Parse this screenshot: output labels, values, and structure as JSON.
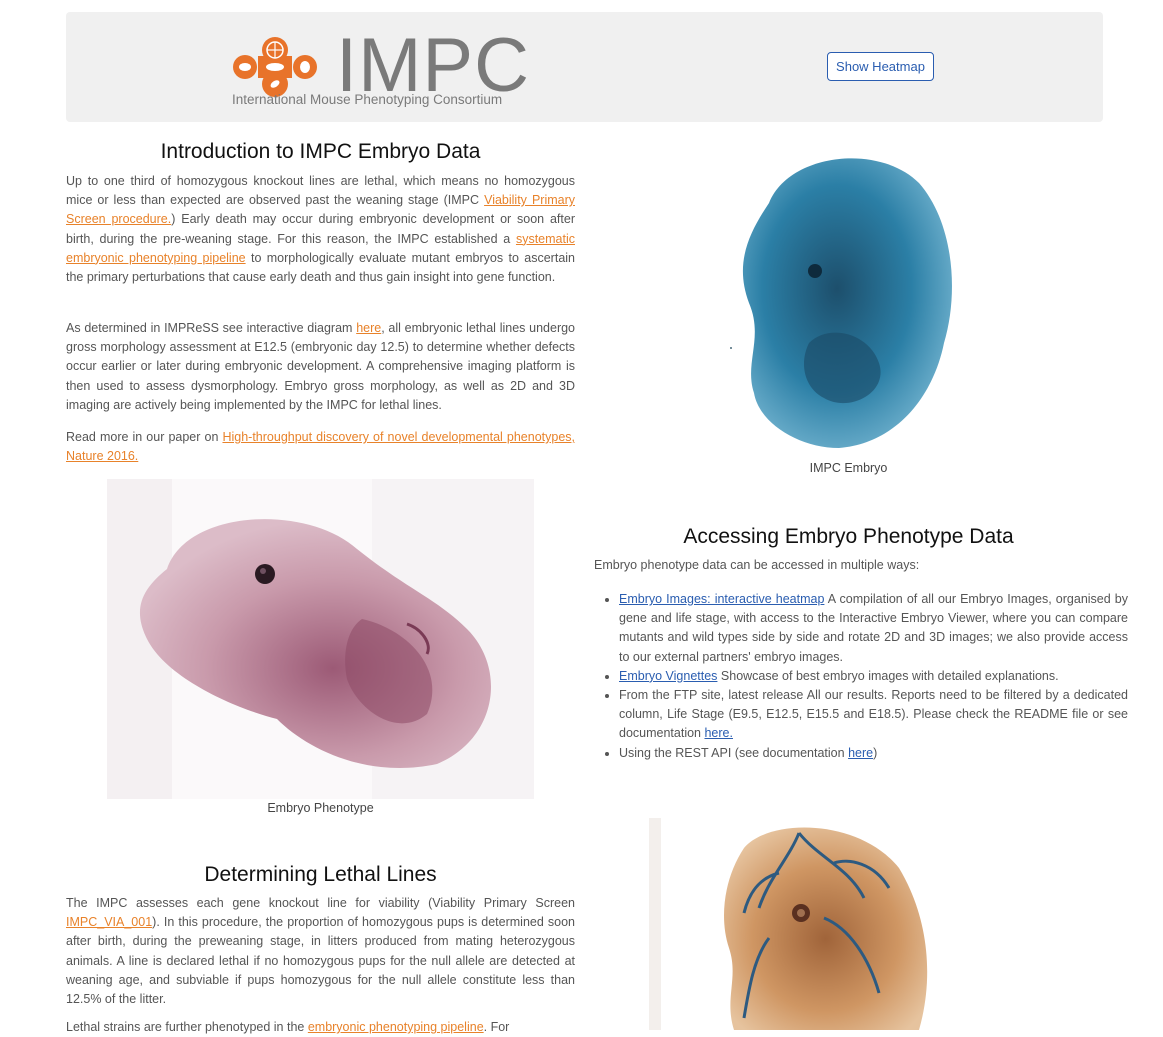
{
  "header": {
    "logo_title": "IMPC",
    "logo_subtitle": "International Mouse Phenotyping Consortium",
    "heatmap_button": "Show Heatmap"
  },
  "intro": {
    "title": "Introduction to IMPC Embryo Data",
    "p1_a": "Up to one third of homozygous knockout lines are lethal, which means no homozygous mice or less than expected are observed past the weaning stage (IMPC ",
    "p1_link1": "Viability Primary Screen procedure.",
    "p1_b": ") Early death may occur during embryonic development or soon after birth, during the pre-weaning stage. For this reason, the IMPC established a ",
    "p1_link2": "systematic embryonic phenotyping pipeline",
    "p1_c": " to morphologically evaluate mutant embryos to ascertain the primary perturbations that cause early death and thus gain insight into gene function.",
    "p2_a": "As determined in IMPReSS see interactive diagram ",
    "p2_link": "here",
    "p2_b": ", all embryonic lethal lines undergo gross morphology assessment at E12.5 (embryonic day 12.5) to determine whether defects occur earlier or later during embryonic development. A comprehensive imaging platform is then used to assess dysmorphology. Embryo gross morphology, as well as 2D and 3D imaging are actively being implemented by the IMPC for lethal lines.",
    "p3_a": "Read more in our paper on ",
    "p3_link": "High-throughput discovery of novel developmental phenotypes, Nature 2016."
  },
  "images": {
    "embryo_caption": "IMPC Embryo",
    "phenotype_caption": "Embryo Phenotype"
  },
  "access": {
    "title": "Accessing Embryo Phenotype Data",
    "intro": "Embryo phenotype data can be accessed in multiple ways:",
    "item1_link": "Embryo Images: interactive heatmap",
    "item1_text": " A compilation of all our Embryo Images, organised by gene and life stage, with access to the Interactive Embryo Viewer, where you can compare mutants and wild types side by side and rotate 2D and 3D images; we also provide access to our external partners' embryo images.",
    "item2_link": "Embryo Vignettes",
    "item2_text": " Showcase of best embryo images with detailed explanations.",
    "item3_text": "From the FTP site, latest release All our results. Reports need to be filtered by a dedicated column, Life Stage (E9.5, E12.5, E15.5 and E18.5). Please check the README file or see documentation ",
    "item3_link": "here.",
    "item4_text": "Using the REST API (see documentation ",
    "item4_link": "here",
    "item4_end": ")"
  },
  "lethal": {
    "title": "Determining Lethal Lines",
    "p1_a": "The IMPC assesses each gene knockout line for viability (Viability Primary Screen ",
    "p1_link": "IMPC_VIA_001",
    "p1_b": "). In this procedure, the proportion of homozygous pups is determined soon after birth, during the preweaning stage, in litters produced from mating heterozygous animals. A line is declared lethal if no homozygous pups for the null allele are detected at weaning age, and subviable if pups homozygous for the null allele constitute less than 12.5% of the litter.",
    "p2_a": "Lethal strains are further phenotyped in the ",
    "p2_link": "embryonic phenotyping pipeline",
    "p2_b": ". For"
  }
}
